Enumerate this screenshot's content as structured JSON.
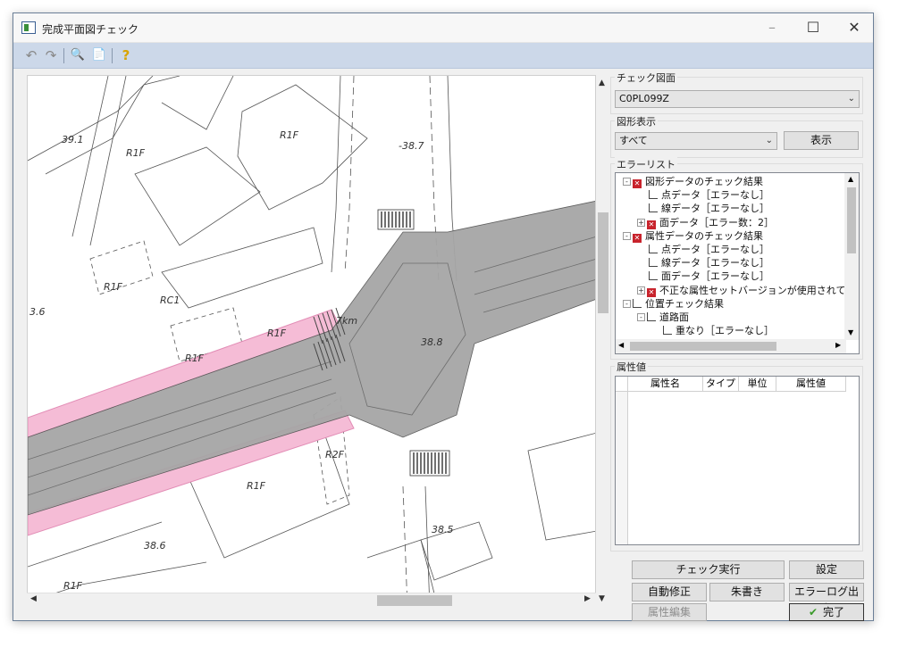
{
  "window": {
    "title": "完成平面図チェック",
    "minimize_icon": "–",
    "maximize_icon": "☐",
    "close_icon": "✕"
  },
  "toolbar": {
    "undo": "↶",
    "redo": "↷",
    "zoom": "🔍",
    "doc": "📄",
    "help": "?"
  },
  "map": {
    "labels": [
      "39.1",
      "R1F",
      "R1F",
      "-38.7",
      "R1F",
      "RC1",
      "R1F",
      "R1F",
      "R2F",
      "R1F",
      "38.6",
      "R1F",
      "38.5",
      "38.8",
      "3.6",
      "7km"
    ]
  },
  "panel": {
    "check_drawing": {
      "label": "チェック図面",
      "value": "C0PL099Z"
    },
    "shape_display": {
      "label": "図形表示",
      "value": "すべて",
      "button": "表示"
    },
    "error_list": {
      "label": "エラーリスト",
      "items": [
        {
          "text": "図形データのチェック結果",
          "mark": "x",
          "level": 0,
          "toggle": "-"
        },
        {
          "text": "点データ［エラーなし］",
          "mark": "ok",
          "level": 1,
          "toggle": ""
        },
        {
          "text": "線データ［エラーなし］",
          "mark": "ok",
          "level": 1,
          "toggle": ""
        },
        {
          "text": "面データ［エラー数：2］",
          "mark": "x",
          "level": 1,
          "toggle": "+"
        },
        {
          "text": "属性データのチェック結果",
          "mark": "x",
          "level": 0,
          "toggle": "-"
        },
        {
          "text": "点データ［エラーなし］",
          "mark": "ok",
          "level": 1,
          "toggle": ""
        },
        {
          "text": "線データ［エラーなし］",
          "mark": "ok",
          "level": 1,
          "toggle": ""
        },
        {
          "text": "面データ［エラーなし］",
          "mark": "ok",
          "level": 1,
          "toggle": ""
        },
        {
          "text": "不正な属性セットバージョンが使用されてい",
          "mark": "x",
          "level": 1,
          "toggle": "+"
        },
        {
          "text": "位置チェック結果",
          "mark": "ok",
          "level": 0,
          "toggle": "-"
        },
        {
          "text": "道路面",
          "mark": "ok",
          "level": 1,
          "toggle": "-"
        },
        {
          "text": "重なり［エラーなし］",
          "mark": "ok",
          "level": 2,
          "toggle": ""
        }
      ]
    },
    "attributes": {
      "label": "属性値",
      "columns": [
        "属性名",
        "タイプ",
        "単位",
        "属性値"
      ]
    },
    "buttons": {
      "run_check": "チェック実行",
      "settings": "設定",
      "auto_fix": "自動修正",
      "red_pen": "朱書き",
      "error_log": "エラーログ出力",
      "edit_attr": "属性編集",
      "done": "完了"
    }
  },
  "colors": {
    "road": "#a6a6a6",
    "pink": "#f5bcd6",
    "toolbar": "#ccd8e9",
    "error": "#c8232c"
  }
}
